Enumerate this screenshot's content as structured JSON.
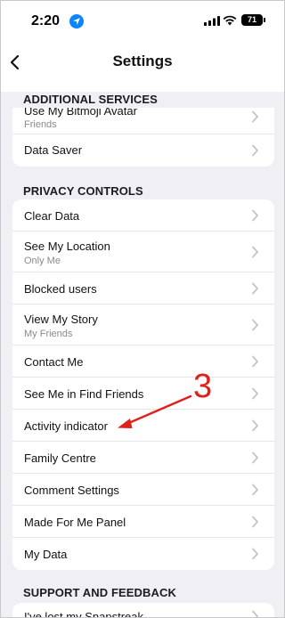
{
  "status_bar": {
    "time": "2:20",
    "battery": "71"
  },
  "nav": {
    "title": "Settings"
  },
  "sections": {
    "additional": {
      "header": "ADDITIONAL SERVICES",
      "items": [
        {
          "label": "Use My Bitmoji Avatar",
          "sub": "Friends"
        },
        {
          "label": "Data Saver",
          "sub": ""
        }
      ]
    },
    "privacy": {
      "header": "PRIVACY CONTROLS",
      "items": [
        {
          "label": "Clear Data",
          "sub": ""
        },
        {
          "label": "See My Location",
          "sub": "Only Me"
        },
        {
          "label": "Blocked users",
          "sub": ""
        },
        {
          "label": "View My Story",
          "sub": "My Friends"
        },
        {
          "label": "Contact Me",
          "sub": ""
        },
        {
          "label": "See Me in Find Friends",
          "sub": ""
        },
        {
          "label": "Activity indicator",
          "sub": ""
        },
        {
          "label": "Family Centre",
          "sub": ""
        },
        {
          "label": "Comment Settings",
          "sub": ""
        },
        {
          "label": "Made For Me Panel",
          "sub": ""
        },
        {
          "label": "My Data",
          "sub": ""
        }
      ]
    },
    "support": {
      "header": "SUPPORT AND FEEDBACK",
      "items": [
        {
          "label": "I've lost my Snapstreak",
          "sub": ""
        }
      ]
    }
  },
  "annotation": {
    "number": "3",
    "color": "#e0201a"
  },
  "icons": {
    "back": "chevron-left-icon",
    "chevron": "chevron-right-icon",
    "location": "location-arrow-icon",
    "signal": "cellular-signal-icon",
    "wifi": "wifi-icon",
    "battery": "battery-icon"
  }
}
